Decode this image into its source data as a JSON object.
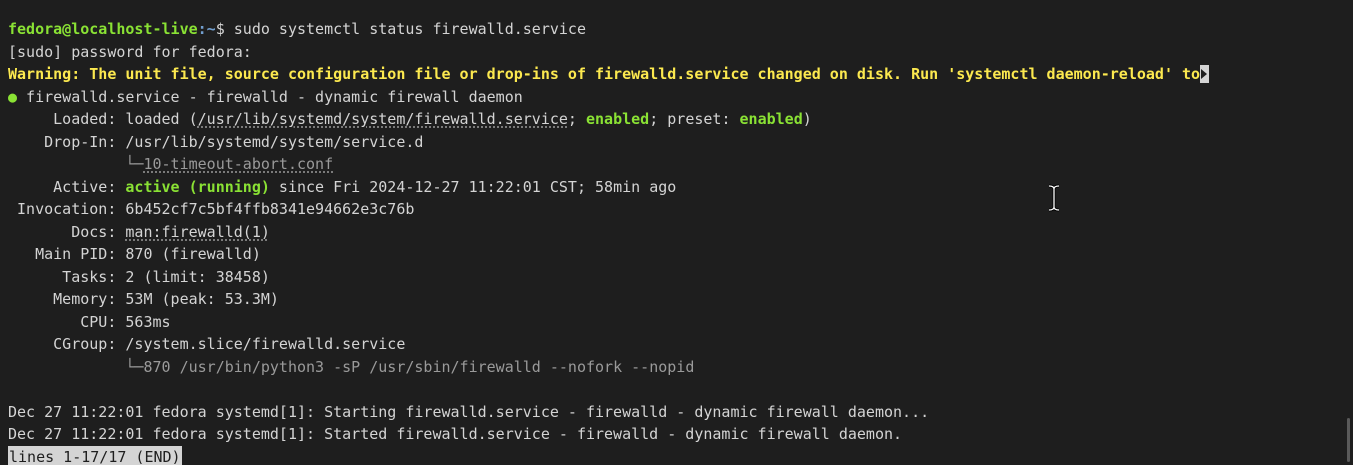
{
  "prompt": {
    "user_host": "fedora@localhost-live",
    "path": ":~",
    "symbol": "$",
    "command": " sudo systemctl status firewalld.service"
  },
  "sudo_prompt": "[sudo] password for fedora:",
  "warning": "Warning: The unit file, source configuration file or drop-ins of firewalld.service changed on disk. Run 'systemctl daemon-reload' to",
  "service_header": {
    "bullet": "●",
    "text": " firewalld.service - firewalld - dynamic firewall daemon"
  },
  "loaded": {
    "label": "     Loaded: ",
    "pre": "loaded (",
    "path": "/usr/lib/systemd/system/firewalld.service",
    "sep1": "; ",
    "enabled": "enabled",
    "sep2": "; preset: ",
    "preset": "enabled",
    "post": ")"
  },
  "dropin": {
    "label": "    Drop-In: ",
    "dir": "/usr/lib/systemd/system/service.d",
    "tree": "             └─",
    "file": "10-timeout-abort.conf"
  },
  "active": {
    "label": "     Active: ",
    "state": "active (running)",
    "since": " since Fri 2024-12-27 11:22:01 CST; 58min ago"
  },
  "invocation": {
    "label": " Invocation: ",
    "value": "6b452cf7c5bf4ffb8341e94662e3c76b"
  },
  "docs": {
    "label": "       Docs: ",
    "value": "man:firewalld(1)"
  },
  "main_pid": {
    "label": "   Main PID: ",
    "value": "870 (firewalld)"
  },
  "tasks": {
    "label": "      Tasks: ",
    "value": "2 (limit: 38458)"
  },
  "memory": {
    "label": "     Memory: ",
    "value": "53M (peak: 53.3M)"
  },
  "cpu": {
    "label": "        CPU: ",
    "value": "563ms"
  },
  "cgroup": {
    "label": "     CGroup: ",
    "value": "/system.slice/firewalld.service",
    "tree": "             └─",
    "process": "870 /usr/bin/python3 -sP /usr/sbin/firewalld --nofork --nopid"
  },
  "log": [
    "Dec 27 11:22:01 fedora systemd[1]: Starting firewalld.service - firewalld - dynamic firewall daemon...",
    "Dec 27 11:22:01 fedora systemd[1]: Started firewalld.service - firewalld - dynamic firewall daemon."
  ],
  "pager_status": "lines 1-17/17 (END)",
  "icons": {
    "text_cursor": "i-beam-cursor-icon",
    "overflow": "right-arrow-icon"
  }
}
